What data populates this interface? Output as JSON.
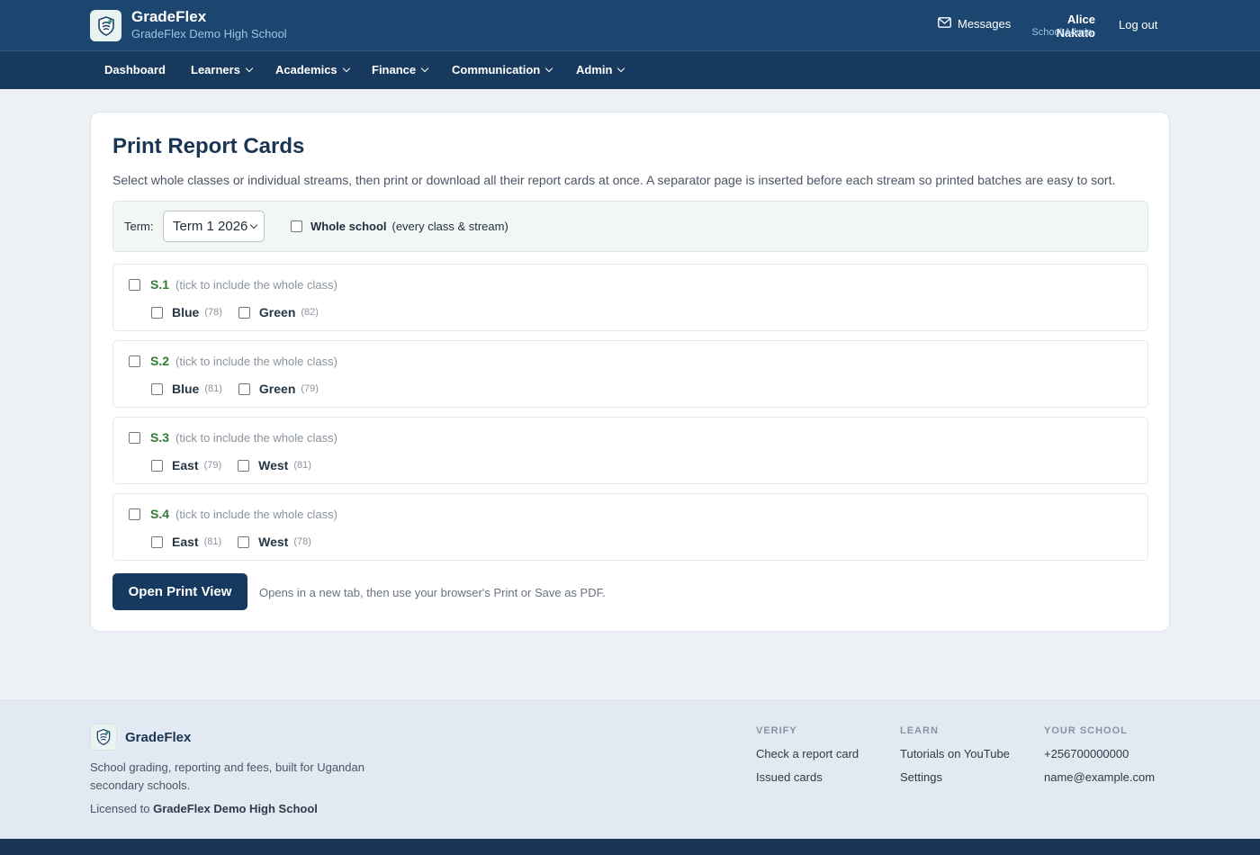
{
  "header": {
    "app_name": "GradeFlex",
    "school_name": "GradeFlex Demo High School",
    "messages_label": "Messages",
    "user_name": "Alice Nakato",
    "user_role": "School Admin",
    "logout_label": "Log out"
  },
  "nav": {
    "items": [
      {
        "label": "Dashboard"
      },
      {
        "label": "Learners"
      },
      {
        "label": "Academics"
      },
      {
        "label": "Finance"
      },
      {
        "label": "Communication"
      },
      {
        "label": "Admin"
      }
    ]
  },
  "main": {
    "title": "Print Report Cards",
    "description": "Select whole classes or individual streams, then print or download all their report cards at once. A separator page is inserted before each stream so printed batches are easy to sort.",
    "term_label": "Term:",
    "term_value": "Term 1 2026",
    "whole_school_label": "Whole school",
    "whole_school_hint": "(every class & stream)",
    "class_hint": "(tick to include the whole class)",
    "classes": [
      {
        "name": "S.1",
        "streams": [
          {
            "name": "Blue",
            "count": "(78)"
          },
          {
            "name": "Green",
            "count": "(82)"
          }
        ]
      },
      {
        "name": "S.2",
        "streams": [
          {
            "name": "Blue",
            "count": "(81)"
          },
          {
            "name": "Green",
            "count": "(79)"
          }
        ]
      },
      {
        "name": "S.3",
        "streams": [
          {
            "name": "East",
            "count": "(79)"
          },
          {
            "name": "West",
            "count": "(81)"
          }
        ]
      },
      {
        "name": "S.4",
        "streams": [
          {
            "name": "East",
            "count": "(81)"
          },
          {
            "name": "West",
            "count": "(78)"
          }
        ]
      }
    ],
    "print_button": "Open Print View",
    "print_note": "Opens in a new tab, then use your browser's Print or Save as PDF."
  },
  "footer": {
    "brand": "GradeFlex",
    "tagline": "School grading, reporting and fees, built for Ugandan secondary schools.",
    "licensed_prefix": "Licensed to",
    "licensed_school": "GradeFlex Demo High School",
    "columns": [
      {
        "heading": "VERIFY",
        "links": [
          "Check a report card",
          "Issued cards"
        ]
      },
      {
        "heading": "LEARN",
        "links": [
          "Tutorials on YouTube",
          "Settings"
        ]
      },
      {
        "heading": "YOUR SCHOOL",
        "links": [
          "+256700000000",
          "name@example.com"
        ]
      }
    ]
  },
  "colors": {
    "header_bg": "#1c4670",
    "nav_bg": "#18395e",
    "primary_button": "#163a5f",
    "class_name_green": "#2e7d32",
    "page_bg": "#edf1f6",
    "footer_bg": "#e2e9f2"
  },
  "icons": {
    "logo": "shield-logo-icon",
    "messages": "envelope-icon",
    "dropdown": "chevron-down-icon"
  }
}
